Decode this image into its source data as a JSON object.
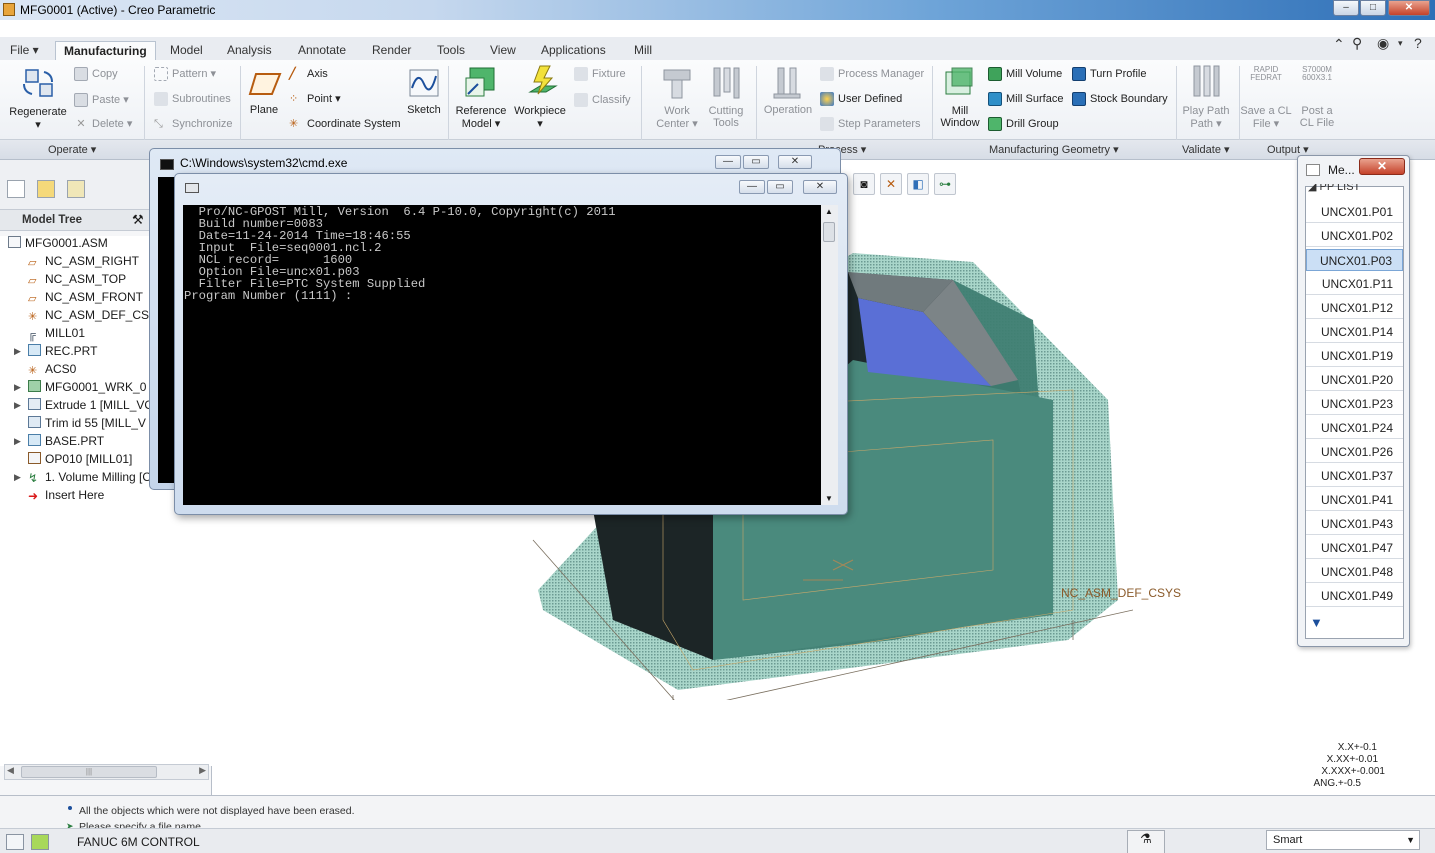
{
  "window": {
    "title": "MFG0001 (Active) - Creo Parametric",
    "buttons": [
      "–",
      "□",
      "✕"
    ]
  },
  "tabs": [
    "File",
    "Manufacturing",
    "Model",
    "Analysis",
    "Annotate",
    "Render",
    "Tools",
    "View",
    "Applications",
    "Mill"
  ],
  "ribbon": {
    "operate": {
      "regenerate": "Regenerate",
      "copy": "Copy",
      "paste": "Paste",
      "delete": "Delete",
      "group": "Operate"
    },
    "edit": {
      "pattern": "Pattern",
      "subroutines": "Subroutines",
      "synchronize": "Synchronize"
    },
    "datum": {
      "plane": "Plane",
      "axis": "Axis",
      "point": "Point",
      "coordinate_system": "Coordinate System",
      "sketch": "Sketch"
    },
    "components": {
      "reference_model": "Reference Model",
      "workpiece": "Workpiece",
      "fixture": "Fixture",
      "classify": "Classify"
    },
    "tool": {
      "work_center": "Work Center",
      "cutting_tools": "Cutting Tools"
    },
    "process": {
      "operation": "Operation",
      "process_manager": "Process Manager",
      "user_defined": "User Defined",
      "step_parameters": "Step Parameters",
      "group": "Process"
    },
    "mfg_geometry": {
      "mill_window": "Mill Window",
      "mill_volume": "Mill Volume",
      "mill_surface": "Mill Surface",
      "drill_group": "Drill Group",
      "turn_profile": "Turn Profile",
      "stock_boundary": "Stock Boundary",
      "group": "Manufacturing Geometry"
    },
    "validate": {
      "play_path": "Play Path",
      "group": "Validate"
    },
    "output": {
      "rapid_label": "RAPID FEDRAT",
      "save_cl": "Save a CL File",
      "s_label": "S7000M 600X3.1",
      "post_cl": "Post a CL File",
      "group": "Output"
    }
  },
  "model_tree": {
    "title": "Model Tree",
    "nodes": [
      "MFG0001.ASM",
      "NC_ASM_RIGHT",
      "NC_ASM_TOP",
      "NC_ASM_FRONT",
      "NC_ASM_DEF_CS",
      "MILL01",
      "REC.PRT",
      "ACS0",
      "MFG0001_WRK_0",
      "Extrude 1 [MILL_VO",
      "Trim id 55 [MILL_V",
      "BASE.PRT",
      "OP010 [MILL01]",
      "1. Volume Milling [O",
      "Insert Here"
    ]
  },
  "cmd": {
    "outer_title": "C:\\Windows\\system32\\cmd.exe",
    "lines": [
      "  Pro/NC-GPOST Mill, Version  6.4 P-10.0, Copyright(c) 2011",
      "  Build number=0083",
      "  Date=11-24-2014 Time=18:46:55",
      "  Input  File=seq0001.ncl.2",
      "  NCL record=      1600",
      "  Option File=uncx01.p03",
      "  Filter File=PTC System Supplied",
      "Program Number (1111) :"
    ]
  },
  "menu_manager": {
    "title": "Me...",
    "header": "PP LIST",
    "items": [
      "UNCX01.P01",
      "UNCX01.P02",
      "UNCX01.P03",
      "UNCX01.P11",
      "UNCX01.P12",
      "UNCX01.P14",
      "UNCX01.P19",
      "UNCX01.P20",
      "UNCX01.P23",
      "UNCX01.P24",
      "UNCX01.P26",
      "UNCX01.P37",
      "UNCX01.P41",
      "UNCX01.P43",
      "UNCX01.P47",
      "UNCX01.P48",
      "UNCX01.P49"
    ],
    "selected": "UNCX01.P03"
  },
  "graphics": {
    "csys_label": "NC_ASM_DEF_CSYS",
    "tolerances": [
      "X.X+-0.1",
      "X.XX+-0.01",
      "X.XXX+-0.001",
      "ANG.+-0.5"
    ]
  },
  "status": {
    "messages": [
      "All the objects which were not displayed have been erased.",
      "Please specify a file name"
    ],
    "machine": "FANUC 6M CONTROL",
    "filter": "Smart"
  }
}
